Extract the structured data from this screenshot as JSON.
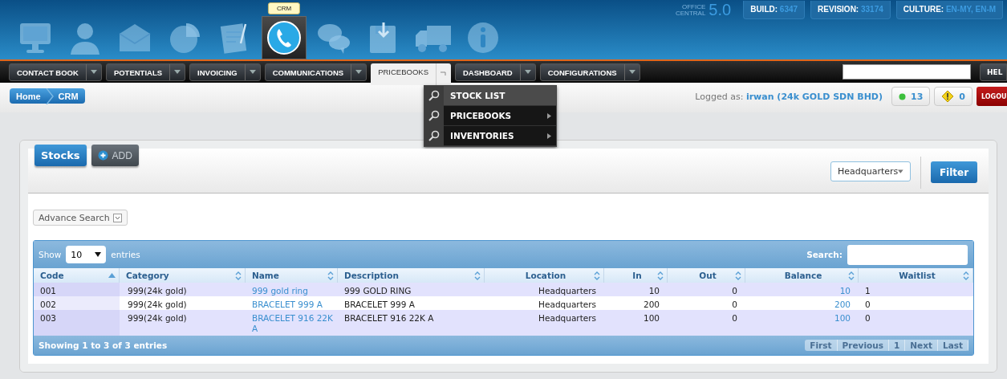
{
  "app_icons": [
    {
      "kind": "monitor",
      "selected": false
    },
    {
      "kind": "person",
      "selected": false
    },
    {
      "kind": "envelope",
      "selected": false
    },
    {
      "kind": "pie",
      "selected": false
    },
    {
      "kind": "document",
      "selected": false
    },
    {
      "kind": "phone",
      "selected": true,
      "tooltip": "CRM"
    },
    {
      "kind": "chat",
      "selected": false
    },
    {
      "kind": "floppy",
      "selected": false
    },
    {
      "kind": "truck",
      "selected": false
    },
    {
      "kind": "info",
      "selected": false
    }
  ],
  "product": {
    "name_line1": "OFFICE",
    "name_line2": "CENTRAL",
    "version": "5.0"
  },
  "info_badges": [
    {
      "label": "BUILD:",
      "value": "6347"
    },
    {
      "label": "REVISION:",
      "value": "33174"
    },
    {
      "label": "CULTURE:",
      "value": "EN-MY, EN-M"
    }
  ],
  "nav_menu": [
    {
      "label": "CONTACT BOOK",
      "selected": false
    },
    {
      "label": "POTENTIALS",
      "selected": false
    },
    {
      "label": "INVOICING",
      "selected": false
    },
    {
      "label": "COMMUNICATIONS",
      "selected": false
    },
    {
      "label": "PRICEBOOKS",
      "selected": true
    },
    {
      "label": "DASHBOARD",
      "selected": false
    },
    {
      "label": "CONFIGURATIONS",
      "selected": false
    }
  ],
  "help_button": "HEL",
  "dropdown": [
    {
      "label": "STOCK LIST",
      "selected": true,
      "submenu": false
    },
    {
      "label": "PRICEBOOKS",
      "selected": false,
      "submenu": true
    },
    {
      "label": "INVENTORIES",
      "selected": false,
      "submenu": true
    }
  ],
  "breadcrumb": [
    "Home",
    "CRM"
  ],
  "logged_as": {
    "label": "Logged as:",
    "user": "irwan (24k GOLD SDN BHD)"
  },
  "status_badges": [
    {
      "kind": "online",
      "count": "13"
    },
    {
      "kind": "warning",
      "count": "0"
    }
  ],
  "logout_button": "LOGOU",
  "panel": {
    "tabs": [
      {
        "label": "Stocks",
        "selected": true
      },
      {
        "label": "ADD",
        "selected": false
      }
    ],
    "location_select": "Headquarters",
    "filter_button": "Filter",
    "advance_search": "Advance Search"
  },
  "table": {
    "show_label": "Show",
    "page_size": "10",
    "entries_label": "entries",
    "search_label": "Search:",
    "columns": [
      {
        "label": "Code",
        "sorted": true
      },
      {
        "label": "Category",
        "sorted": false
      },
      {
        "label": "Name",
        "sorted": false
      },
      {
        "label": "Description",
        "sorted": false
      },
      {
        "label": "Location",
        "sorted": false
      },
      {
        "label": "In",
        "sorted": false
      },
      {
        "label": "Out",
        "sorted": false
      },
      {
        "label": "Balance",
        "sorted": false
      },
      {
        "label": "Waitlist",
        "sorted": false
      }
    ],
    "rows": [
      [
        "001",
        "999(24k gold)",
        "999 gold ring",
        "999 GOLD RING",
        "Headquarters",
        "10",
        "0",
        "10",
        "1"
      ],
      [
        "002",
        "999(24k gold)",
        "BRACELET 999 A",
        "BRACELET 999 A",
        "Headquarters",
        "200",
        "0",
        "200",
        "0"
      ],
      [
        "003",
        "999(24k gold)",
        "BRACELET 916 22K A",
        "BRACELET 916 22K A",
        "Headquarters",
        "100",
        "0",
        "100",
        "0"
      ]
    ],
    "info": "Showing 1 to 3 of 3 entries",
    "pagination": [
      {
        "label": "First",
        "disabled": true
      },
      {
        "label": "Previous",
        "disabled": true
      },
      {
        "label": "1",
        "disabled": true
      },
      {
        "label": "Next",
        "disabled": true
      },
      {
        "label": "Last",
        "disabled": true
      }
    ]
  }
}
